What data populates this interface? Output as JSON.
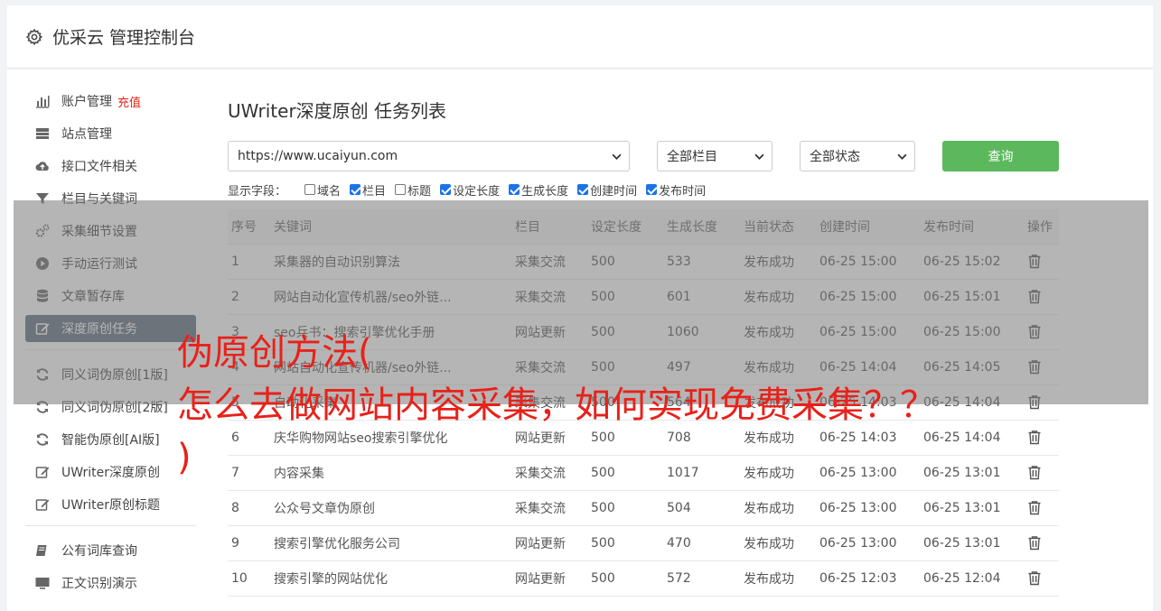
{
  "header": {
    "title": "优采云 管理控制台"
  },
  "sidebar": {
    "group1": [
      {
        "label": "账户管理",
        "extra": "充值",
        "icon": "bar-chart-icon"
      },
      {
        "label": "站点管理",
        "icon": "server-icon"
      },
      {
        "label": "接口文件相关",
        "icon": "cloud-upload-icon"
      },
      {
        "label": "栏目与关键词",
        "icon": "filter-icon"
      },
      {
        "label": "采集细节设置",
        "icon": "gears-icon"
      },
      {
        "label": "手动运行测试",
        "icon": "play-circle-icon"
      },
      {
        "label": "文章暂存库",
        "icon": "database-icon"
      },
      {
        "label": "深度原创任务",
        "icon": "edit-icon",
        "active": true
      }
    ],
    "group2": [
      {
        "label": "同义词伪原创[1版]",
        "icon": "refresh-icon"
      },
      {
        "label": "同义词伪原创[2版]",
        "icon": "refresh-icon"
      },
      {
        "label": "智能伪原创[AI版]",
        "icon": "refresh-icon"
      },
      {
        "label": "UWriter深度原创",
        "icon": "edit-icon"
      },
      {
        "label": "UWriter原创标题",
        "icon": "edit-icon"
      }
    ],
    "group3": [
      {
        "label": "公有词库查询",
        "icon": "book-icon"
      },
      {
        "label": "正文识别演示",
        "icon": "monitor-icon"
      }
    ]
  },
  "main": {
    "title": "UWriter深度原创 任务列表",
    "url_select": "https://www.ucaiyun.com",
    "column_select": "全部栏目",
    "status_select": "全部状态",
    "query_label": "查询",
    "fields_label": "显示字段：",
    "fields": [
      {
        "label": "域名",
        "checked": false
      },
      {
        "label": "栏目",
        "checked": true
      },
      {
        "label": "标题",
        "checked": false
      },
      {
        "label": "设定长度",
        "checked": true
      },
      {
        "label": "生成长度",
        "checked": true
      },
      {
        "label": "创建时间",
        "checked": true
      },
      {
        "label": "发布时间",
        "checked": true
      }
    ],
    "columns": [
      "序号",
      "关键词",
      "栏目",
      "设定长度",
      "生成长度",
      "当前状态",
      "创建时间",
      "发布时间",
      "操作"
    ],
    "rows": [
      [
        "1",
        "采集器的自动识别算法",
        "采集交流",
        "500",
        "533",
        "发布成功",
        "06-25 15:00",
        "06-25 15:02"
      ],
      [
        "2",
        "网站自动化宣传机器/seo外链...",
        "采集交流",
        "500",
        "601",
        "发布成功",
        "06-25 15:00",
        "06-25 15:01"
      ],
      [
        "3",
        "seo兵书：搜索引擎优化手册",
        "网站更新",
        "500",
        "1060",
        "发布成功",
        "06-25 15:00",
        "06-25 15:00"
      ],
      [
        "4",
        "网站自动化宣传机器/seo外链...",
        "采集交流",
        "500",
        "497",
        "发布成功",
        "06-25 14:04",
        "06-25 14:05"
      ],
      [
        "5",
        "自动化采集",
        "采集交流",
        "500",
        "564",
        "发布成功",
        "06-25 14:03",
        "06-25 14:04"
      ],
      [
        "6",
        "庆华购物网站seo搜索引擎优化",
        "网站更新",
        "500",
        "708",
        "发布成功",
        "06-25 14:03",
        "06-25 14:04"
      ],
      [
        "7",
        "内容采集",
        "采集交流",
        "500",
        "1017",
        "发布成功",
        "06-25 13:00",
        "06-25 13:01"
      ],
      [
        "8",
        "公众号文章伪原创",
        "采集交流",
        "500",
        "504",
        "发布成功",
        "06-25 13:00",
        "06-25 13:01"
      ],
      [
        "9",
        "搜索引擎优化服务公司",
        "网站更新",
        "500",
        "470",
        "发布成功",
        "06-25 13:00",
        "06-25 13:01"
      ],
      [
        "10",
        "搜索引擎的网站优化",
        "网站更新",
        "500",
        "572",
        "发布成功",
        "06-25 12:03",
        "06-25 12:04"
      ]
    ]
  },
  "overlay": {
    "text": "伪原创方法(\n怎么去做网站内容采集，如何实现免费采集？？\n)"
  },
  "colors": {
    "active_nav": "#5d6d7e",
    "query_button": "#5cb85c",
    "status_success": "#2e8b2e",
    "overlay_text": "#e8211a",
    "recharge": "#e1251b"
  }
}
